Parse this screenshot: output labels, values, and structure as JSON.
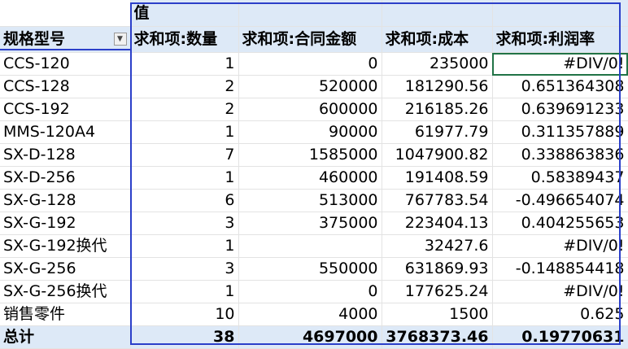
{
  "pivot": {
    "values_caption": "值",
    "row_field": "规格型号",
    "columns": [
      "求和项:数量",
      "求和项:合同金额",
      "求和项:成本",
      "求和项:利润率"
    ],
    "rows": [
      {
        "label": "CCS-120",
        "qty": "1",
        "amount": "0",
        "cost": "235000",
        "margin": "#DIV/0!"
      },
      {
        "label": "CCS-128",
        "qty": "2",
        "amount": "520000",
        "cost": "181290.56",
        "margin": "0.651364308"
      },
      {
        "label": "CCS-192",
        "qty": "2",
        "amount": "600000",
        "cost": "216185.26",
        "margin": "0.639691233"
      },
      {
        "label": "MMS-120A4",
        "qty": "1",
        "amount": "90000",
        "cost": "61977.79",
        "margin": "0.311357889"
      },
      {
        "label": "SX-D-128",
        "qty": "7",
        "amount": "1585000",
        "cost": "1047900.82",
        "margin": "0.338863836"
      },
      {
        "label": "SX-D-256",
        "qty": "1",
        "amount": "460000",
        "cost": "191408.59",
        "margin": "0.58389437"
      },
      {
        "label": "SX-G-128",
        "qty": "6",
        "amount": "513000",
        "cost": "767783.54",
        "margin": "-0.496654074"
      },
      {
        "label": "SX-G-192",
        "qty": "3",
        "amount": "375000",
        "cost": "223404.13",
        "margin": "0.404255653"
      },
      {
        "label": "SX-G-192换代",
        "qty": "1",
        "amount": "",
        "cost": "32427.6",
        "margin": "#DIV/0!"
      },
      {
        "label": "SX-G-256",
        "qty": "3",
        "amount": "550000",
        "cost": "631869.93",
        "margin": "-0.148854418"
      },
      {
        "label": "SX-G-256换代",
        "qty": "1",
        "amount": "0",
        "cost": "177625.24",
        "margin": "#DIV/0!"
      },
      {
        "label": "销售零件",
        "qty": "10",
        "amount": "4000",
        "cost": "1500",
        "margin": "0.625"
      }
    ],
    "total": {
      "label": "总计",
      "qty": "38",
      "amount": "4697000",
      "cost": "3768373.46",
      "margin": "0.19770631"
    }
  },
  "icons": {
    "filter_dropdown": "chevron-down-icon"
  },
  "colors": {
    "header_fill": "#dde9f7",
    "pivot_border": "#2b3fc9",
    "active_cell_border": "#217346"
  }
}
